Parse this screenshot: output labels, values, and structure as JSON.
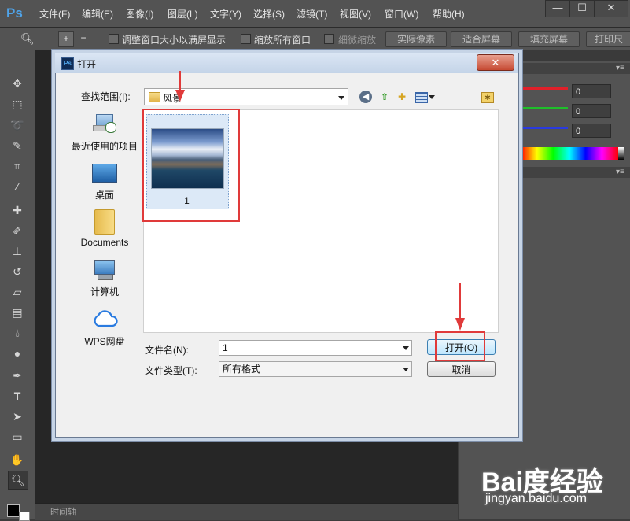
{
  "app": {
    "logo": "Ps",
    "menu": [
      "文件(F)",
      "编辑(E)",
      "图像(I)",
      "图层(L)",
      "文字(Y)",
      "选择(S)",
      "滤镜(T)",
      "视图(V)",
      "窗口(W)",
      "帮助(H)"
    ],
    "window_buttons": [
      "—",
      "☐",
      "✕"
    ]
  },
  "options_bar": {
    "resize_windows": "调整窗口大小以满屏显示",
    "zoom_all": "缩放所有窗口",
    "scrubby_zoom": "细微缩放",
    "actual_pixels": "实际像素",
    "fit_screen": "适合屏幕",
    "fill_screen": "填充屏幕",
    "print_size": "打印尺"
  },
  "panels": {
    "color_values": [
      "0",
      "0",
      "0"
    ],
    "slider_colors": [
      "#e0202a",
      "#1fbf2a",
      "#2a3ae0"
    ]
  },
  "timeline": {
    "label": "时间轴"
  },
  "dialog": {
    "title": "打开",
    "close": "✕",
    "look_in_label": "查找范围(I):",
    "look_in_value": "风景",
    "places": [
      {
        "label": "最近使用的项目",
        "icon": "recent-places-icon"
      },
      {
        "label": "桌面",
        "icon": "desktop-icon"
      },
      {
        "label": "Documents",
        "icon": "documents-folder-icon"
      },
      {
        "label": "计算机",
        "icon": "computer-icon"
      },
      {
        "label": "WPS网盘",
        "icon": "wps-cloud-icon"
      }
    ],
    "file": {
      "name": "1"
    },
    "file_name_label": "文件名(N):",
    "file_name_value": "1",
    "file_type_label": "文件类型(T):",
    "file_type_value": "所有格式",
    "open_button": "打开(O)",
    "cancel_button": "取消"
  },
  "watermark": {
    "logo": "Bai度经验",
    "url": "jingyan.baidu.com"
  }
}
